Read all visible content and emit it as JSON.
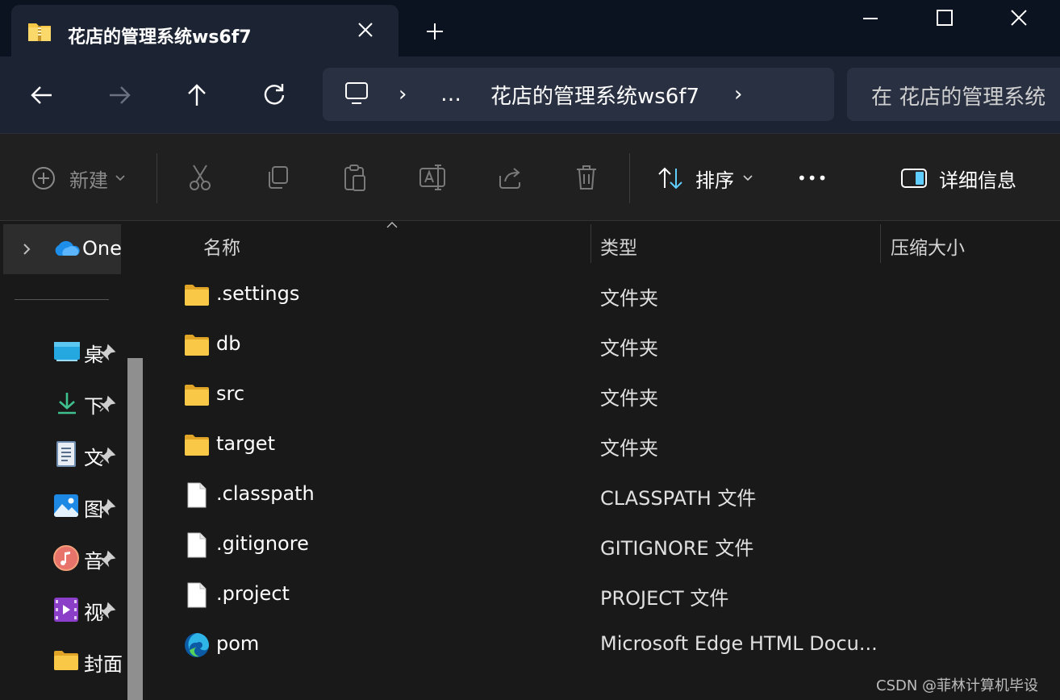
{
  "window": {
    "tab_title": "花店的管理系统ws6f7",
    "tab_icon": "folder-zip-icon"
  },
  "navigation": {
    "breadcrumb_separator": "›",
    "breadcrumb_more": "…",
    "breadcrumb_current": "花店的管理系统ws6f7",
    "search_placeholder": "在 花店的管理系统"
  },
  "commandbar": {
    "new_label": "新建",
    "sort_label": "排序",
    "more_label": "•••",
    "details_label": "详细信息"
  },
  "sidebar": {
    "onedrive_label": "One",
    "items": [
      {
        "label": "桌",
        "icon": "desktop-icon"
      },
      {
        "label": "下",
        "icon": "download-icon"
      },
      {
        "label": "文",
        "icon": "documents-icon"
      },
      {
        "label": "图",
        "icon": "pictures-icon"
      },
      {
        "label": "音",
        "icon": "music-icon"
      },
      {
        "label": "视",
        "icon": "videos-icon"
      },
      {
        "label": "封面",
        "icon": "folder-icon"
      }
    ]
  },
  "columns": {
    "name": "名称",
    "type": "类型",
    "size": "压缩大小"
  },
  "files": [
    {
      "name": ".settings",
      "type": "文件夹",
      "icon": "folder-icon"
    },
    {
      "name": "db",
      "type": "文件夹",
      "icon": "folder-icon"
    },
    {
      "name": "src",
      "type": "文件夹",
      "icon": "folder-icon"
    },
    {
      "name": "target",
      "type": "文件夹",
      "icon": "folder-icon"
    },
    {
      "name": ".classpath",
      "type": "CLASSPATH 文件",
      "icon": "file-icon"
    },
    {
      "name": ".gitignore",
      "type": "GITIGNORE 文件",
      "icon": "file-icon"
    },
    {
      "name": ".project",
      "type": "PROJECT 文件",
      "icon": "file-icon"
    },
    {
      "name": "pom",
      "type": "Microsoft Edge HTML Docu...",
      "icon": "edge-icon"
    }
  ],
  "watermark": "CSDN @菲林计算机毕设",
  "colors": {
    "titlebar": "#0c1320",
    "navbar": "#1c2333",
    "address": "#283041",
    "commandbar": "#202020",
    "content": "#191919",
    "folder": "#f8c846",
    "accent": "#60cdff"
  }
}
